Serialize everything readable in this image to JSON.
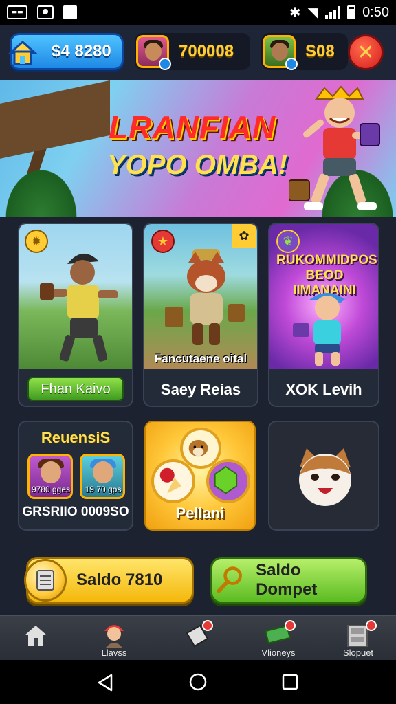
{
  "statusbar": {
    "time": "0:50",
    "icons": [
      "news-icon",
      "camera-icon",
      "notes-icon",
      "bluetooth-icon",
      "wifi-icon",
      "signal-icon",
      "battery-icon"
    ]
  },
  "hud": {
    "coins": "$4 8280",
    "player2_score": "700008",
    "player3_score": "S08"
  },
  "banner": {
    "title": "LRANFIAN",
    "subtitle": "YOPO OMBA!"
  },
  "cards": [
    {
      "label": "Fhan Kaivo"
    },
    {
      "overlay": "Fancutaene oital",
      "label": "Saey Reias"
    },
    {
      "title": "RUKOMMIDPOSI BEOD IIMANAINI",
      "label": "XOK Levih"
    }
  ],
  "rewards": {
    "title": "ReuensiS",
    "mini1_label": "9780 gges",
    "mini2_label": "19 70 gps",
    "score": "GRSRIIO 0009SO"
  },
  "gold_card": {
    "label": "Pellani"
  },
  "actions": {
    "saldo": "Saldo 7810",
    "dompet": "Saldo Dompet"
  },
  "nav": {
    "items": [
      "",
      "Llavss",
      "",
      "Vlioneys",
      "Slopuet"
    ]
  },
  "colors": {
    "hud_bg": "#1e2536",
    "gold": "#ffcc33",
    "accent_blue": "#1e88e5",
    "accent_green": "#5cbc22",
    "accent_yellow": "#f4b80c",
    "danger": "#d81e1e"
  }
}
